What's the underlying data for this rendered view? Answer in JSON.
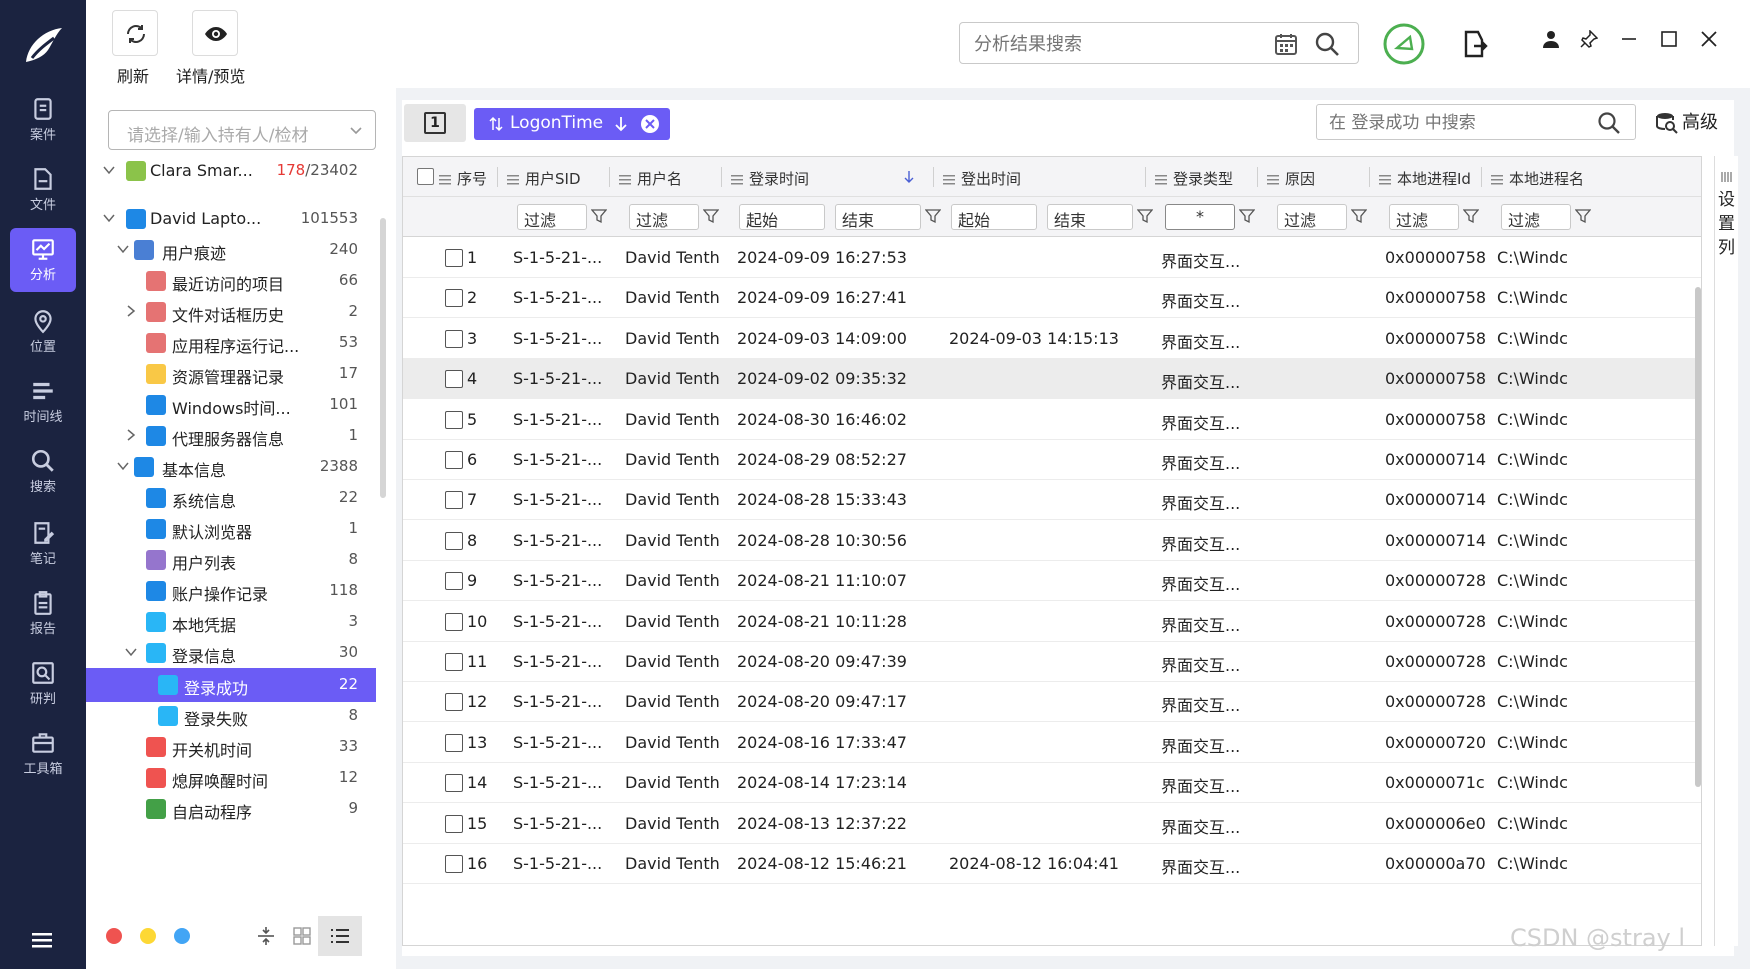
{
  "nav": {
    "items": [
      {
        "label": "案件",
        "icon": "case-icon"
      },
      {
        "label": "文件",
        "icon": "file-icon"
      },
      {
        "label": "分析",
        "icon": "analysis-icon"
      },
      {
        "label": "位置",
        "icon": "location-icon"
      },
      {
        "label": "时间线",
        "icon": "timeline-icon"
      },
      {
        "label": "搜索",
        "icon": "search-icon"
      },
      {
        "label": "笔记",
        "icon": "notes-icon"
      },
      {
        "label": "报告",
        "icon": "report-icon"
      },
      {
        "label": "研判",
        "icon": "judge-icon"
      },
      {
        "label": "工具箱",
        "icon": "toolbox-icon"
      }
    ],
    "active": "分析"
  },
  "toolbar": {
    "refresh_label": "刷新",
    "details_label": "详情/预览",
    "search_placeholder": "分析结果搜索"
  },
  "tree": {
    "select_placeholder": "请选择/输入持有人/检材",
    "nodes": [
      {
        "label": "Clara Smar...",
        "count_red": "178",
        "count": "/23402",
        "icon": "android-icon",
        "color": "#8bc34a"
      },
      {
        "label": "David Lapto...",
        "count": "101553",
        "icon": "windows-icon",
        "color": "#1e88e5"
      },
      {
        "label": "用户痕迹",
        "count": "240",
        "icon": "user-trace-icon",
        "color": "#4a7fd4"
      },
      {
        "label": "最近访问的项目",
        "count": "66",
        "icon": "clock-icon",
        "color": "#e57373"
      },
      {
        "label": "文件对话框历史",
        "count": "2",
        "icon": "clock-icon",
        "color": "#e57373"
      },
      {
        "label": "应用程序运行记...",
        "count": "53",
        "icon": "clock-icon",
        "color": "#e57373"
      },
      {
        "label": "资源管理器记录",
        "count": "17",
        "icon": "folder-icon",
        "color": "#f9c846"
      },
      {
        "label": "Windows时间...",
        "count": "101",
        "icon": "timeline-list-icon",
        "color": "#1e88e5"
      },
      {
        "label": "代理服务器信息",
        "count": "1",
        "icon": "list-card-icon",
        "color": "#1e88e5"
      },
      {
        "label": "基本信息",
        "count": "2388",
        "icon": "doc-list-icon",
        "color": "#1e88e5"
      },
      {
        "label": "系统信息",
        "count": "22",
        "icon": "list-card-icon",
        "color": "#1e88e5"
      },
      {
        "label": "默认浏览器",
        "count": "1",
        "icon": "ie-icon",
        "color": "#1e88e5"
      },
      {
        "label": "用户列表",
        "count": "8",
        "icon": "user-icon",
        "color": "#9575cd"
      },
      {
        "label": "账户操作记录",
        "count": "118",
        "icon": "list-card-icon",
        "color": "#1e88e5"
      },
      {
        "label": "本地凭据",
        "count": "3",
        "icon": "key-icon",
        "color": "#29b6f6"
      },
      {
        "label": "登录信息",
        "count": "30",
        "icon": "login-icon",
        "color": "#29b6f6"
      },
      {
        "label": "登录成功",
        "count": "22",
        "icon": "login-icon",
        "color": "#29b6f6"
      },
      {
        "label": "登录失败",
        "count": "8",
        "icon": "login-icon",
        "color": "#29b6f6"
      },
      {
        "label": "开关机时间",
        "count": "33",
        "icon": "power-icon",
        "color": "#ef5350"
      },
      {
        "label": "熄屏唤醒时间",
        "count": "12",
        "icon": "power-icon",
        "color": "#ef5350"
      },
      {
        "label": "自启动程序",
        "count": "9",
        "icon": "play-icon",
        "color": "#43a047"
      }
    ]
  },
  "main": {
    "page_button": "1",
    "sort_chip": "LogonTime",
    "inner_search_placeholder": "在 登录成功 中搜索",
    "advanced_label": "高级",
    "settings_label": "设置列",
    "columns": [
      "序号",
      "用户SID",
      "用户名",
      "登录时间",
      "登出时间",
      "登录类型",
      "原因",
      "本地进程Id",
      "本地进程名"
    ],
    "filters": {
      "filter": "过滤",
      "start": "起始",
      "end": "结束",
      "star": "*"
    },
    "rows": [
      [
        "1",
        "S-1-5-21-...",
        "David Tenth",
        "2024-09-09 16:27:53",
        "",
        "界面交互...",
        "",
        "0x00000758",
        "C:\\Windc"
      ],
      [
        "2",
        "S-1-5-21-...",
        "David Tenth",
        "2024-09-09 16:27:41",
        "",
        "界面交互...",
        "",
        "0x00000758",
        "C:\\Windc"
      ],
      [
        "3",
        "S-1-5-21-...",
        "David Tenth",
        "2024-09-03 14:09:00",
        "2024-09-03 14:15:13",
        "界面交互...",
        "",
        "0x00000758",
        "C:\\Windc"
      ],
      [
        "4",
        "S-1-5-21-...",
        "David Tenth",
        "2024-09-02 09:35:32",
        "",
        "界面交互...",
        "",
        "0x00000758",
        "C:\\Windc"
      ],
      [
        "5",
        "S-1-5-21-...",
        "David Tenth",
        "2024-08-30 16:46:02",
        "",
        "界面交互...",
        "",
        "0x00000758",
        "C:\\Windc"
      ],
      [
        "6",
        "S-1-5-21-...",
        "David Tenth",
        "2024-08-29 08:52:27",
        "",
        "界面交互...",
        "",
        "0x00000714",
        "C:\\Windc"
      ],
      [
        "7",
        "S-1-5-21-...",
        "David Tenth",
        "2024-08-28 15:33:43",
        "",
        "界面交互...",
        "",
        "0x00000714",
        "C:\\Windc"
      ],
      [
        "8",
        "S-1-5-21-...",
        "David Tenth",
        "2024-08-28 10:30:56",
        "",
        "界面交互...",
        "",
        "0x00000714",
        "C:\\Windc"
      ],
      [
        "9",
        "S-1-5-21-...",
        "David Tenth",
        "2024-08-21 11:10:07",
        "",
        "界面交互...",
        "",
        "0x00000728",
        "C:\\Windc"
      ],
      [
        "10",
        "S-1-5-21-...",
        "David Tenth",
        "2024-08-21 10:11:28",
        "",
        "界面交互...",
        "",
        "0x00000728",
        "C:\\Windc"
      ],
      [
        "11",
        "S-1-5-21-...",
        "David Tenth",
        "2024-08-20 09:47:39",
        "",
        "界面交互...",
        "",
        "0x00000728",
        "C:\\Windc"
      ],
      [
        "12",
        "S-1-5-21-...",
        "David Tenth",
        "2024-08-20 09:47:17",
        "",
        "界面交互...",
        "",
        "0x00000728",
        "C:\\Windc"
      ],
      [
        "13",
        "S-1-5-21-...",
        "David Tenth",
        "2024-08-16 17:33:47",
        "",
        "界面交互...",
        "",
        "0x00000720",
        "C:\\Windc"
      ],
      [
        "14",
        "S-1-5-21-...",
        "David Tenth",
        "2024-08-14 17:23:14",
        "",
        "界面交互...",
        "",
        "0x0000071c",
        "C:\\Windc"
      ],
      [
        "15",
        "S-1-5-21-...",
        "David Tenth",
        "2024-08-13 12:37:22",
        "",
        "界面交互...",
        "",
        "0x000006e0",
        "C:\\Windc"
      ],
      [
        "16",
        "S-1-5-21-...",
        "David Tenth",
        "2024-08-12 15:46:21",
        "2024-08-12 16:04:41",
        "界面交互...",
        "",
        "0x00000a70",
        "C:\\Windc"
      ]
    ]
  },
  "watermark": "CSDN @stray l",
  "colors": {
    "accent": "#6b5cf5",
    "nav_bg": "#1b2340",
    "count_red": "#e53935"
  }
}
